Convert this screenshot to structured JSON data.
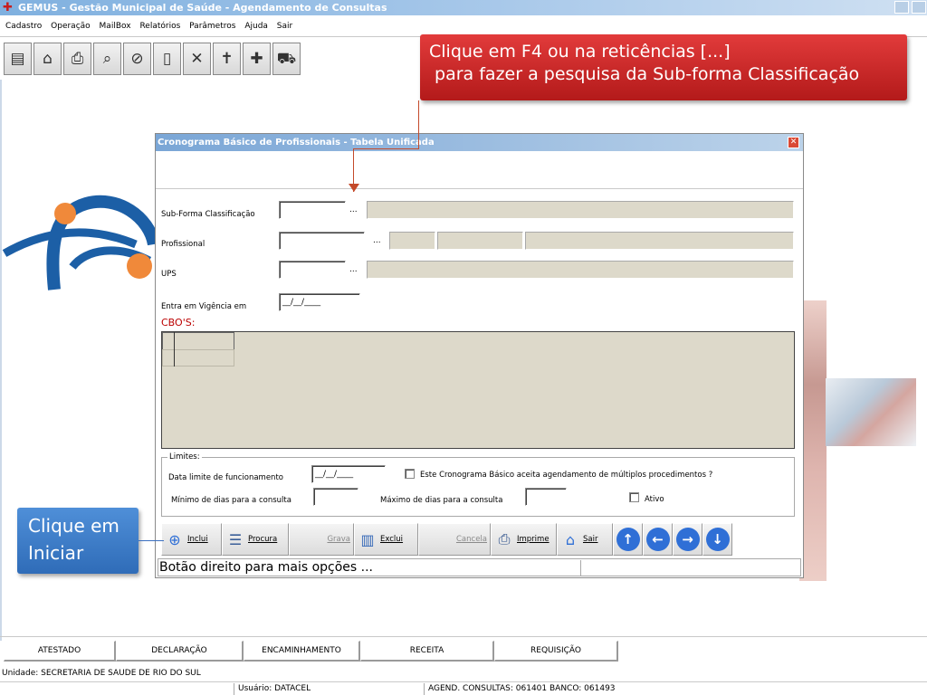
{
  "window": {
    "title": "GEMUS - Gestão Municipal de Saúde - Agendamento de Consultas"
  },
  "menu": [
    "Cadastro",
    "Operação",
    "MailBox",
    "Relatórios",
    "Parâmetros",
    "Ajuda",
    "Sair"
  ],
  "toolbar_icons": [
    "monitor-icon",
    "building-icon",
    "printer-icon",
    "magnifier-icon",
    "pill-icon",
    "clipboard-icon",
    "tools-icon",
    "cross-icon",
    "first-aid-kit-icon",
    "ambulance-icon"
  ],
  "callouts": {
    "f4": {
      "line1": "Clique em F4 ou na reticências [...]",
      "line2": " para fazer a pesquisa da Sub-forma Classificação"
    },
    "iniciar": {
      "line1": "Clique em",
      "line2": "Iniciar"
    }
  },
  "dialog": {
    "title": "Cronograma Básico de Profissionais - Tabela Unificada",
    "fields": {
      "subforma": {
        "label": "Sub-Forma Classificação",
        "value": "",
        "ellipsis": "..."
      },
      "profissional": {
        "label": "Profissional",
        "value": "",
        "ellipsis": "..."
      },
      "ups": {
        "label": "UPS",
        "value": "",
        "ellipsis": "..."
      },
      "vigencia": {
        "label": "Entra em Vigência em",
        "value": "__/__/____"
      }
    },
    "cbo_label": "CBO'S:",
    "limites": {
      "legend": "Limites:",
      "data_limite_label": "Data limite de funcionamento",
      "data_limite_value": "__/__/____",
      "multiplos_label": "Este Cronograma Básico aceita agendamento de múltiplos procedimentos ?",
      "multiplos_checked": false,
      "minimo_label": "Mínimo de dias para  a consulta",
      "minimo_value": "",
      "maximo_label": "Máximo de dias para a consulta",
      "maximo_value": "",
      "ativo_label": "Ativo",
      "ativo_checked": false
    },
    "buttons": {
      "inclui": "Inclui",
      "procura": "Procura",
      "grava": "Grava",
      "exclui": "Exclui",
      "cancela": "Cancela",
      "imprime": "Imprime",
      "sair": "Sair"
    },
    "status": "Botão direito para mais opções ..."
  },
  "bottom_tabs": [
    "ATESTADO",
    "DECLARAÇÃO",
    "ENCAMINHAMENTO",
    "RECEITA",
    "REQUISIÇÃO"
  ],
  "unidade": "Unidade: SECRETARIA DE SAUDE DE RIO DO SUL",
  "statusbar": {
    "usuario": "Usuário: DATACEL",
    "agend": "AGEND. CONSULTAS: 061401  BANCO: 061493"
  },
  "colors": {
    "callout_red": "#c9302c",
    "callout_blue": "#3a7ccd",
    "readonly_field": "#ddd9ca",
    "nav_circle": "#2f6fd6"
  }
}
